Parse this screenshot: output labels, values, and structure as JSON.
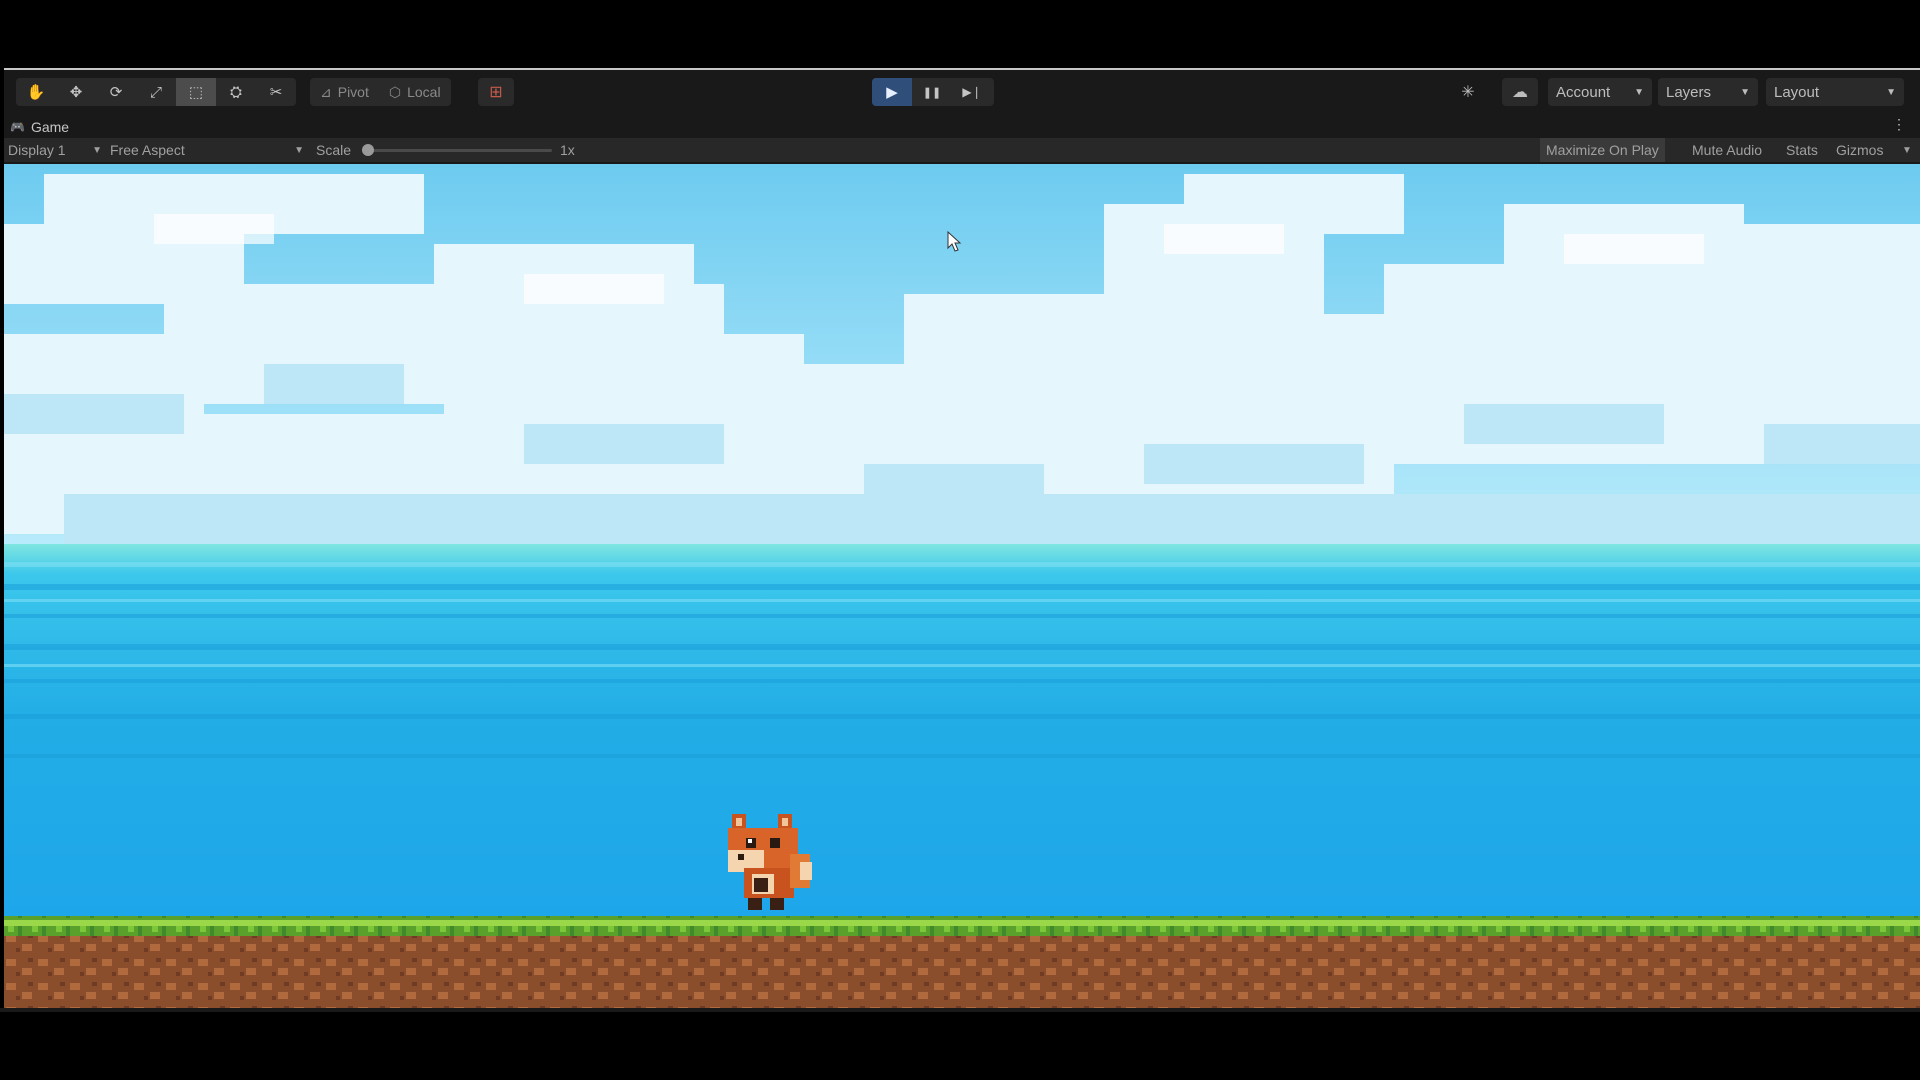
{
  "toolbar": {
    "tools": [
      {
        "name": "hand-tool-icon",
        "glyph": "✋"
      },
      {
        "name": "move-tool-icon",
        "glyph": "✥"
      },
      {
        "name": "rotate-tool-icon",
        "glyph": "⟳"
      },
      {
        "name": "scale-tool-icon",
        "glyph": "⤢"
      },
      {
        "name": "rect-tool-icon",
        "glyph": "⬚"
      },
      {
        "name": "transform-tool-icon",
        "glyph": "⛭"
      },
      {
        "name": "custom-tool-icon",
        "glyph": "✂"
      }
    ],
    "pivot_label": "Pivot",
    "local_label": "Local",
    "grid_snap_icon": "grid-snap-icon",
    "play_glyph": "▶",
    "pause_glyph": "❚❚",
    "step_glyph": "▶❘",
    "account_label": "Account",
    "layers_label": "Layers",
    "layout_label": "Layout"
  },
  "tab": {
    "game_label": "Game"
  },
  "gamebar": {
    "display_label": "Display 1",
    "aspect_label": "Free Aspect",
    "scale_label": "Scale",
    "scale_value": "1x",
    "scale_level": 0.0,
    "maximize_label": "Maximize On Play",
    "mute_label": "Mute Audio",
    "stats_label": "Stats",
    "gizmos_label": "Gizmos"
  },
  "colors": {
    "sky_top": "#7fd3f2",
    "cloud": "#e8f7fd",
    "sea": "#29b6e8",
    "grass": "#7cc63a",
    "dirt": "#9a5a34",
    "play_active": "#2f4f7a"
  }
}
